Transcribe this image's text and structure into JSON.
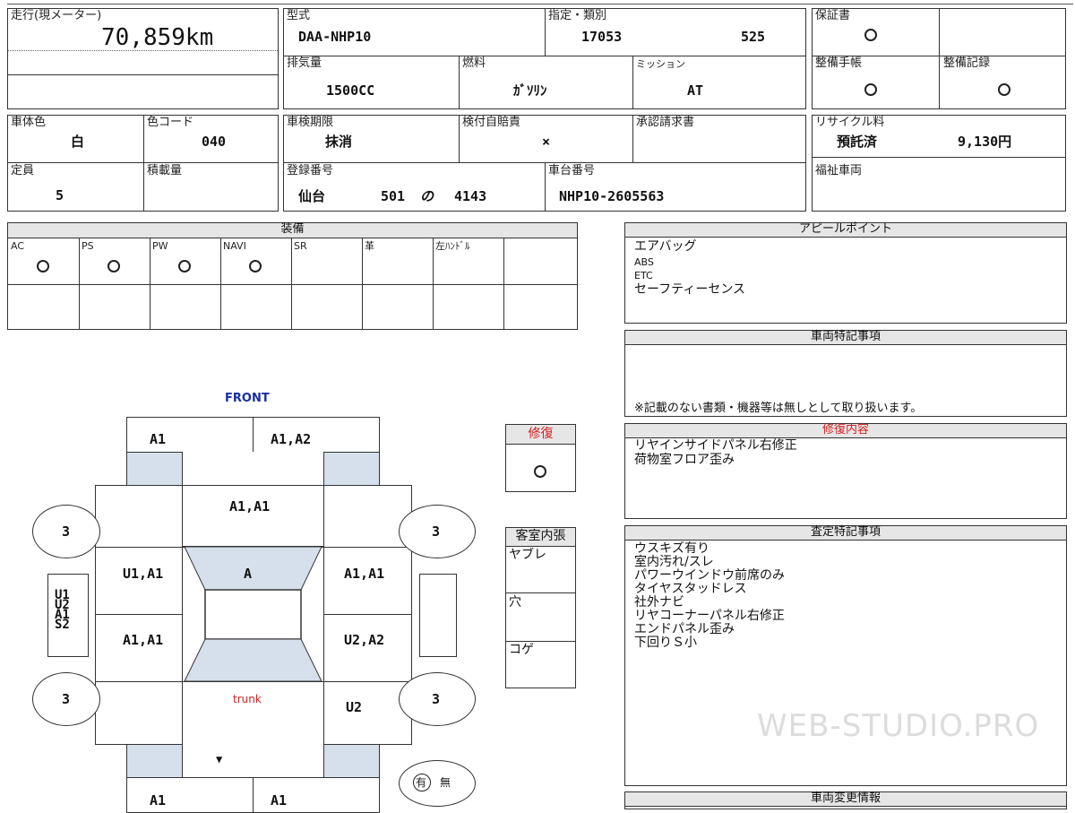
{
  "vehicle": {
    "mileage_label": "走行(現メーター)",
    "mileage_value": "70,859km",
    "model_label": "型式",
    "model_value": "DAA-NHP10",
    "designation_label": "指定・類別",
    "designation_value": "17053",
    "category_value": "525",
    "displacement_label": "排気量",
    "displacement_value": "1500CC",
    "fuel_label": "燃料",
    "fuel_value": "ｶﾞｿﾘﾝ",
    "transmission_label": "ミッション",
    "transmission_value": "AT",
    "color_label": "車体色",
    "color_value": "白",
    "color_code_label": "色コード",
    "color_code_value": "040",
    "inspection_label": "車検期限",
    "inspection_value": "抹消",
    "insurance_label": "検付自賠責",
    "insurance_value": "×",
    "approval_label": "承認請求書",
    "capacity_label": "定員",
    "capacity_value": "5",
    "load_label": "積載量",
    "registration_label": "登録番号",
    "reg_city": "仙台",
    "reg_class": "501",
    "reg_kana": "の",
    "reg_number": "4143",
    "chassis_label": "車台番号",
    "chassis_value": "NHP10-2605563"
  },
  "docs": {
    "warranty_label": "保証書",
    "warranty_value": "○",
    "maintenance_book_label": "整備手帳",
    "maintenance_book_value": "○",
    "maintenance_record_label": "整備記録",
    "maintenance_record_value": "○",
    "recycle_label": "リサイクル料",
    "recycle_status": "預託済",
    "recycle_amount": "9,130円",
    "welfare_label": "福祉車両"
  },
  "equipment": {
    "title": "装備",
    "items": [
      {
        "label": "AC",
        "value": "○"
      },
      {
        "label": "PS",
        "value": "○"
      },
      {
        "label": "PW",
        "value": "○"
      },
      {
        "label": "NAVI",
        "value": "○"
      },
      {
        "label": "SR",
        "value": ""
      },
      {
        "label": "革",
        "value": ""
      },
      {
        "label": "左ﾊﾝﾄﾞﾙ",
        "value": ""
      }
    ]
  },
  "diagram": {
    "front_label": "FRONT",
    "trunk_label": "trunk",
    "cells": {
      "front_left": "A1",
      "front_right": "A1,A2",
      "hood": "A1,A1",
      "tire_fl": "3",
      "tire_fr": "3",
      "tire_rl": "3",
      "tire_rr": "3",
      "door_fl": "U1,A1",
      "roof_front": "A",
      "door_fr": "A1,A1",
      "door_rl": "A1,A1",
      "door_rr": "U2,A2",
      "quarter_rr": "U2",
      "side_left": "U1\nU2\nA1\nS2",
      "rear_left": "A1",
      "rear_right": "A1"
    },
    "yes_label": "有",
    "no_label": "無"
  },
  "repair": {
    "label": "修復",
    "value": "○"
  },
  "interior": {
    "title": "客室内張",
    "items": [
      "ヤブレ",
      "穴",
      "コゲ"
    ]
  },
  "appeal": {
    "title": "アピールポイント",
    "lines": [
      "エアバッグ",
      "ABS",
      "ETC",
      "セーフティーセンス"
    ]
  },
  "special_notes": {
    "title": "車両特記事項",
    "note": "※記載のない書類・機器等は無しとして取り扱います。"
  },
  "repair_details": {
    "title": "修復内容",
    "lines": [
      "リヤインサイドパネル右修正",
      "荷物室フロア歪み"
    ]
  },
  "assessment": {
    "title": "査定特記事項",
    "lines": [
      "ウスキズ有り",
      "室内汚れ/スレ",
      "パワーウインドウ前席のみ",
      "タイヤスタッドレス",
      "社外ナビ",
      "リヤコーナーパネル右修正",
      "エンドパネル歪み",
      "下回りＳ小"
    ]
  },
  "change_info": {
    "title": "車両変更情報"
  },
  "watermark": "WEB-STUDIO.PRO",
  "colors": {
    "repair_title": "#d32020",
    "front_label": "#1a2fa0",
    "trunk_label": "#d32020",
    "panel_fill": "#d6e0ec",
    "header_fill": "#e6e6e6"
  }
}
